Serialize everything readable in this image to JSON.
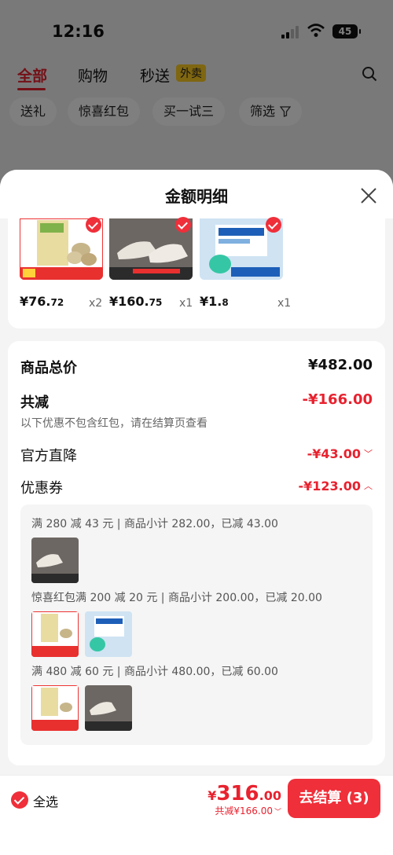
{
  "status": {
    "time": "12:16",
    "battery": "45"
  },
  "top_tabs": [
    {
      "label": "全部"
    },
    {
      "label": "购物"
    },
    {
      "label": "秒送"
    }
  ],
  "waimai_tag": "外卖",
  "filter_chips": [
    "送礼",
    "惊喜红包",
    "买一试三",
    "筛选"
  ],
  "sheet": {
    "title": "金额明细",
    "products": [
      {
        "price_int": "¥76.",
        "price_dec": "72",
        "qty": "x2",
        "icon": "pistachio-product"
      },
      {
        "price_int": "¥160.",
        "price_dec": "75",
        "qty": "x1",
        "icon": "sneaker-product"
      },
      {
        "price_int": "¥1.",
        "price_dec": "8",
        "qty": "x1",
        "icon": "wipes-product"
      }
    ],
    "total_label": "商品总价",
    "total_value": "¥482.00",
    "discount_label": "共减",
    "discount_value": "-¥166.00",
    "discount_note": "以下优惠不包含红包，请在结算页查看",
    "direct_label": "官方直降",
    "direct_value": "-¥43.00",
    "coupon_label": "优惠券",
    "coupon_value": "-¥123.00",
    "coupons": [
      {
        "text": "满 280 减 43 元 | 商品小计 282.00，已减 43.00"
      },
      {
        "text": "惊喜红包满 200 减 20 元 | 商品小计 200.00，已减 20.00"
      },
      {
        "text": "满 480 减 60 元 | 商品小计 480.00，已减 60.00"
      }
    ]
  },
  "bottom": {
    "select_all": "全选",
    "currency": "¥",
    "total_int": "316",
    "total_dec": ".00",
    "saved": "共减¥166.00",
    "checkout": "去结算 (3)"
  },
  "colors": {
    "accent": "#ef2f3a",
    "price_red": "#e8222f"
  }
}
